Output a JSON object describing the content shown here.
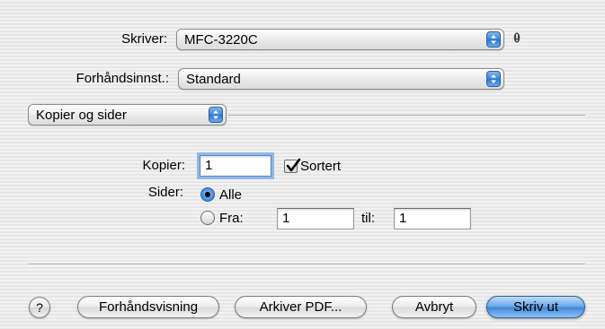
{
  "printer": {
    "label": "Skriver:",
    "value": "MFC-3220C"
  },
  "presets": {
    "label": "Forhåndsinnst.:",
    "value": "Standard"
  },
  "panel": {
    "value": "Kopier og sider"
  },
  "copies": {
    "label": "Kopier:",
    "value": "1",
    "collate_label": "Sortert",
    "collate_checked": true
  },
  "pages": {
    "label": "Sider:",
    "all_label": "Alle",
    "from_label": "Fra:",
    "from_value": "1",
    "to_label": "til:",
    "to_value": "1",
    "selected": "all"
  },
  "buttons": {
    "help": "?",
    "preview": "Forhåndsvisning",
    "save_pdf": "Arkiver PDF...",
    "cancel": "Avbryt",
    "print": "Skriv ut"
  },
  "icons": [
    "warning-icon",
    "popup-stepper-icon",
    "checkmark-icon"
  ],
  "colors": {
    "accent": "#3f86d8"
  }
}
